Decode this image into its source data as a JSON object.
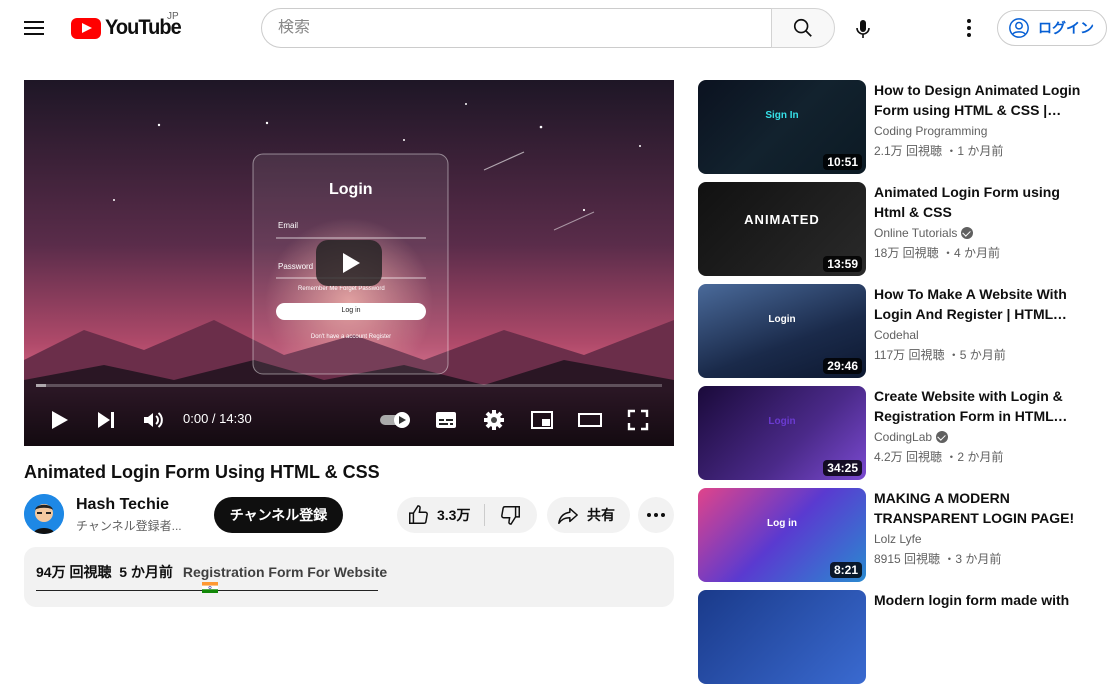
{
  "header": {
    "logo_text": "YouTube",
    "region": "JP",
    "search_placeholder": "検索",
    "login_label": "ログイン"
  },
  "player": {
    "time": "0:00 / 14:30",
    "progress": 0,
    "overlay": {
      "login_title": "Login",
      "email_label": "Email",
      "password_label": "Password",
      "remember": "Remember Me  Forget Password",
      "button": "Log in",
      "register": "Don't have a account  Register"
    }
  },
  "video": {
    "title": "Animated Login Form Using HTML & CSS",
    "channel": "Hash Techie",
    "subscribers": "チャンネル登録者...",
    "subscribe_label": "チャンネル登録",
    "likes": "3.3万",
    "share_label": "共有",
    "views": "94万 回視聴",
    "age": "5 か月前",
    "description_head": "Registration Form For Website"
  },
  "recommendations": [
    {
      "title": "How to Design Animated Login Form using HTML & CSS | Ste...",
      "channel": "Coding Programming",
      "verified": false,
      "meta": "2.1万 回視聴 ・1 か月前",
      "duration": "10:51",
      "thumb_text": "Sign In"
    },
    {
      "title": "Animated Login Form using Html & CSS",
      "channel": "Online Tutorials",
      "verified": true,
      "meta": "18万 回視聴 ・4 か月前",
      "duration": "13:59",
      "thumb_text": "ANIMATED"
    },
    {
      "title": "How To Make A Website With Login And Register | HTML CS...",
      "channel": "Codehal",
      "verified": false,
      "meta": "117万 回視聴 ・5 か月前",
      "duration": "29:46",
      "thumb_text": "Login"
    },
    {
      "title": "Create Website with Login & Registration Form in HTML CS...",
      "channel": "CodingLab",
      "verified": true,
      "meta": "4.2万 回視聴 ・2 か月前",
      "duration": "34:25",
      "thumb_text": "Login"
    },
    {
      "title": "MAKING A MODERN TRANSPARENT LOGIN PAGE!",
      "channel": "Lolz Lyfe",
      "verified": false,
      "meta": "8915 回視聴 ・3 か月前",
      "duration": "8:21",
      "thumb_text": "Log in"
    },
    {
      "title": "Modern login form made with",
      "channel": "",
      "verified": false,
      "meta": "",
      "duration": "",
      "thumb_text": ""
    }
  ]
}
